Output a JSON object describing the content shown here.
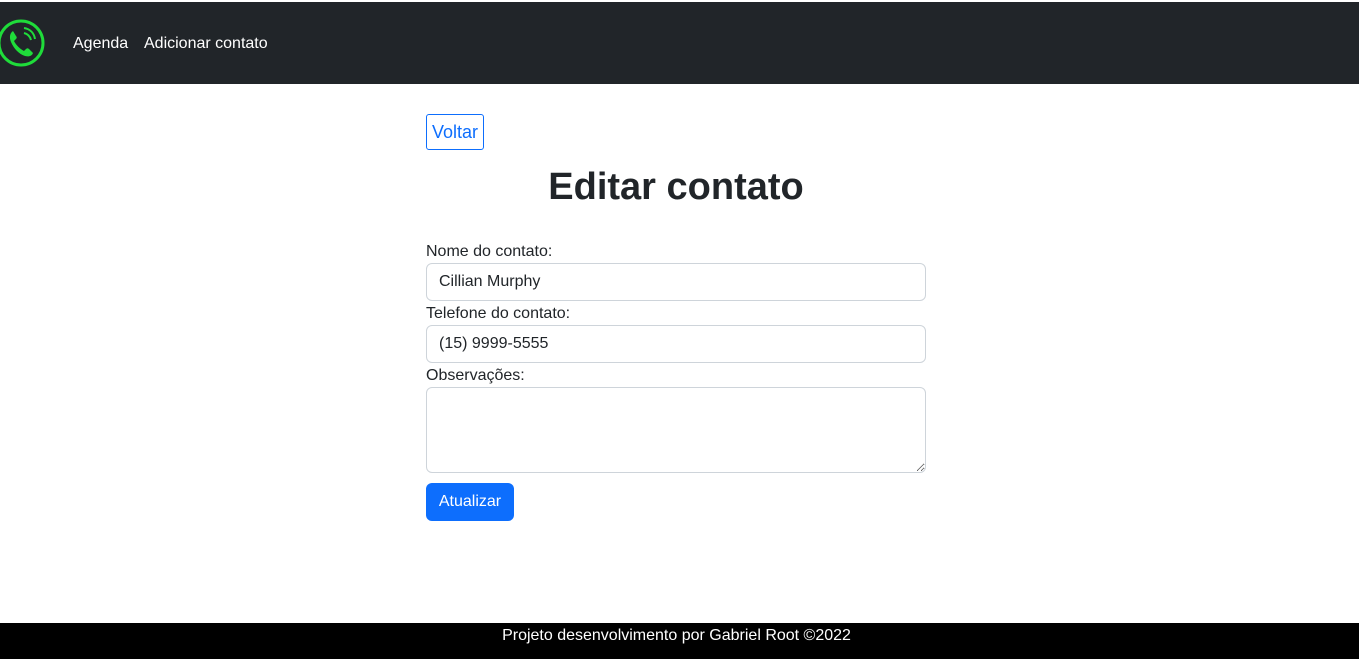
{
  "navbar": {
    "logo_icon": "phone-circle-icon",
    "logo_color": "#1fdc3a",
    "links": [
      {
        "label": "Agenda"
      },
      {
        "label": "Adicionar contato"
      }
    ]
  },
  "main": {
    "back_label": "Voltar",
    "title": "Editar contato",
    "form": {
      "nome_label": "Nome do contato:",
      "nome_value": "Cillian Murphy",
      "telefone_label": "Telefone do contato:",
      "telefone_value": "(15) 9999-5555",
      "observacoes_label": "Observações:",
      "observacoes_value": "",
      "submit_label": "Atualizar"
    }
  },
  "footer": {
    "text": "Projeto desenvolvimento por Gabriel Root ©2022"
  },
  "colors": {
    "navbar_bg": "#212529",
    "primary": "#0d6efd",
    "footer_bg": "#000000"
  }
}
